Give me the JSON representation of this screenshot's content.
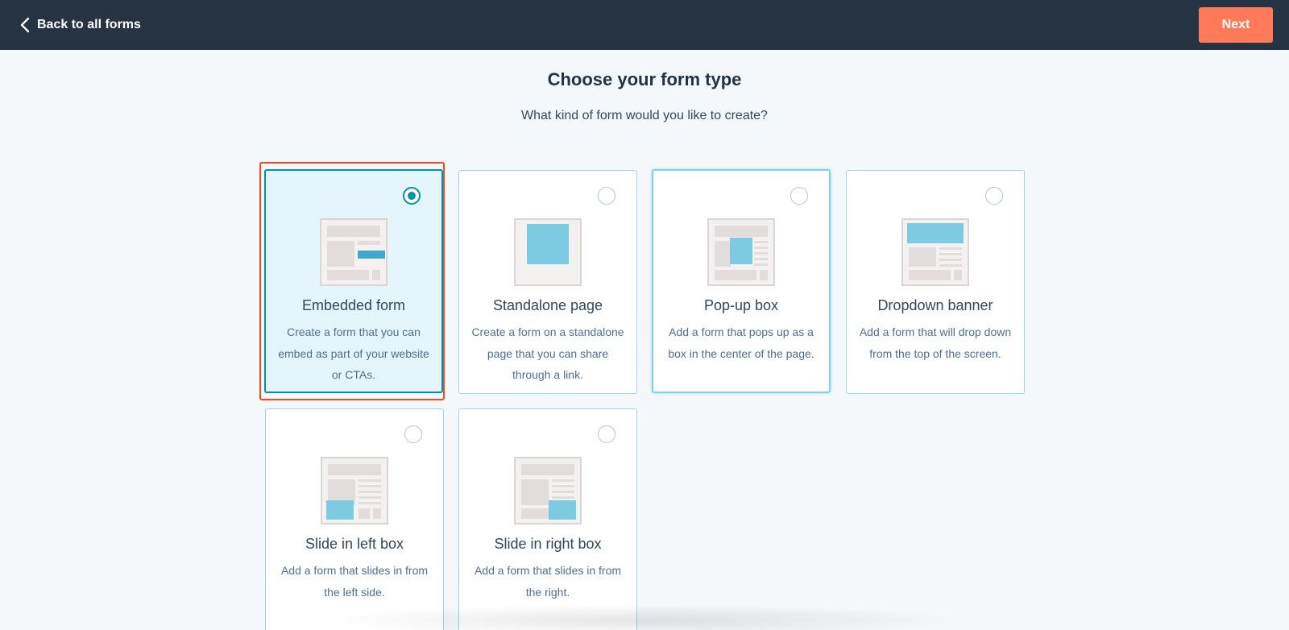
{
  "header": {
    "back_label": "Back to all forms",
    "next_label": "Next"
  },
  "page": {
    "title": "Choose your form type",
    "subtitle": "What kind of form would you like to create?"
  },
  "cards": [
    {
      "title": "Embedded form",
      "description": "Create a form that you can embed as part of your website or CTAs.",
      "selected": true
    },
    {
      "title": "Standalone page",
      "description": "Create a form on a standalone page that you can share through a link.",
      "selected": false
    },
    {
      "title": "Pop-up box",
      "description": "Add a form that pops up as a box in the center of the page.",
      "selected": false
    },
    {
      "title": "Dropdown banner",
      "description": "Add a form that will drop down from the top of the screen.",
      "selected": false
    },
    {
      "title": "Slide in left box",
      "description": "Add a form that slides in from the left side.",
      "selected": false
    },
    {
      "title": "Slide in right box",
      "description": "Add a form that slides in from the right.",
      "selected": false
    }
  ],
  "colors": {
    "topbar": "#253342",
    "accent": "#ff7a59",
    "selected_border": "#0091ae",
    "focus_ring": "#ee4b1f",
    "illustration_blue": "#7dcbe2"
  }
}
